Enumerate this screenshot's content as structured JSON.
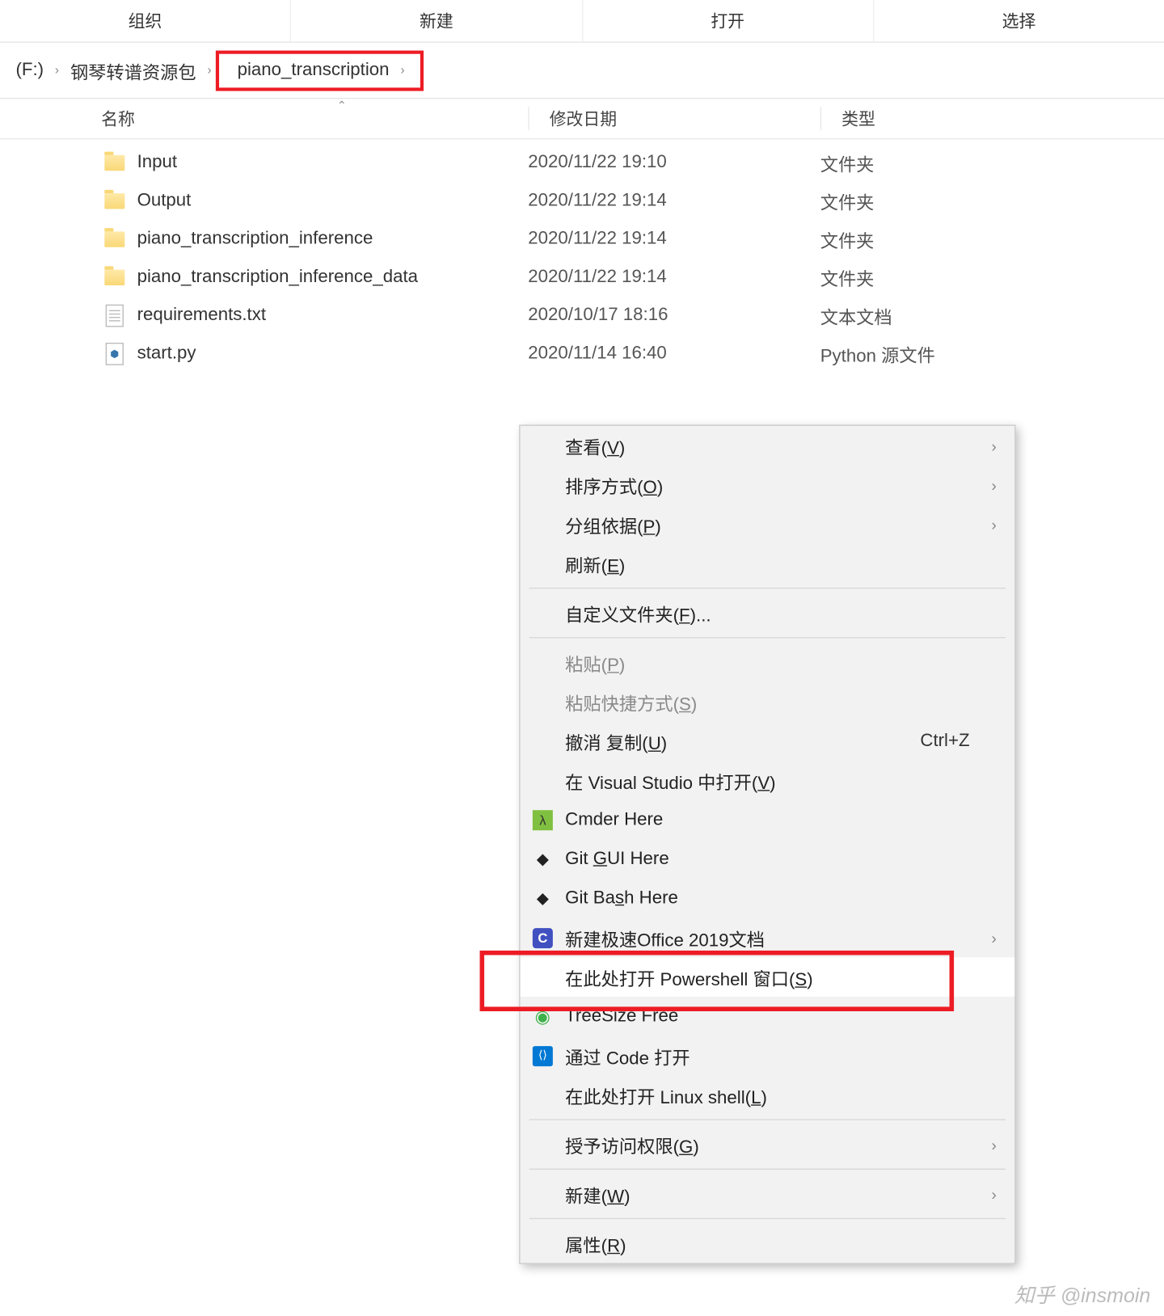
{
  "toolbar": [
    "组织",
    "新建",
    "打开",
    "选择"
  ],
  "breadcrumb": {
    "drive": "(F:)",
    "parent": "钢琴转谱资源包",
    "current": "piano_transcription"
  },
  "columns": {
    "name": "名称",
    "date": "修改日期",
    "type": "类型"
  },
  "files": [
    {
      "icon": "folder",
      "name": "Input",
      "date": "2020/11/22 19:10",
      "type": "文件夹"
    },
    {
      "icon": "folder",
      "name": "Output",
      "date": "2020/11/22 19:14",
      "type": "文件夹"
    },
    {
      "icon": "folder",
      "name": "piano_transcription_inference",
      "date": "2020/11/22 19:14",
      "type": "文件夹"
    },
    {
      "icon": "folder",
      "name": "piano_transcription_inference_data",
      "date": "2020/11/22 19:14",
      "type": "文件夹"
    },
    {
      "icon": "txt",
      "name": "requirements.txt",
      "date": "2020/10/17 18:16",
      "type": "文本文档"
    },
    {
      "icon": "py",
      "name": "start.py",
      "date": "2020/11/14 16:40",
      "type": "Python 源文件"
    }
  ],
  "menu": {
    "view": "查看(V)",
    "sort": "排序方式(O)",
    "group": "分组依据(P)",
    "refresh": "刷新(E)",
    "customize": "自定义文件夹(F)...",
    "paste": "粘贴(P)",
    "paste_shortcut": "粘贴快捷方式(S)",
    "undo": "撤消 复制(U)",
    "undo_shortcut": "Ctrl+Z",
    "vs": "在 Visual Studio 中打开(V)",
    "cmder": "Cmder Here",
    "gitgui": "Git GUI Here",
    "gitbash": "Git Bash Here",
    "office": "新建极速Office 2019文档",
    "powershell": "在此处打开 Powershell 窗口(S)",
    "treesize": "TreeSize Free",
    "code": "通过 Code 打开",
    "linux": "在此处打开 Linux shell(L)",
    "access": "授予访问权限(G)",
    "new": "新建(W)",
    "properties": "属性(R)"
  },
  "watermark": "知乎 @insmoin"
}
